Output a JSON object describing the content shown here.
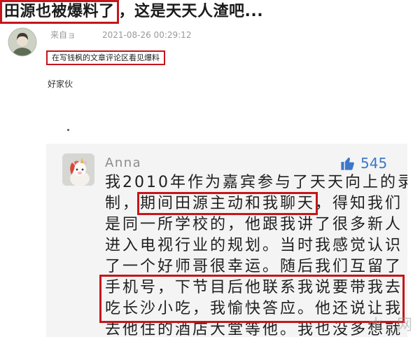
{
  "post": {
    "title_highlight": "田源也被爆料了",
    "title_rest": "，这是天天人渣吧...",
    "author": "来自ョ",
    "timestamp": "2021-08-26 00:29:12",
    "note": "在写钱枫的文章评论区看见爆料",
    "body": "好家伙"
  },
  "quoted_comment": {
    "username": "Anna",
    "like_count": "545",
    "lines": [
      {
        "text": "我2010年作为嘉宾参与了天天向上的录"
      },
      {
        "before": "制，",
        "highlight": "期间田源主动和我聊天",
        "after": "，得知我们"
      },
      {
        "text": "是同一所学校的，他跟我讲了很多新人"
      },
      {
        "text": "进入电视行业的规划。当时我感觉认识"
      },
      {
        "text": "了一个好师哥很幸运。随后我们互留了"
      },
      {
        "text": "手机号，下节目后他联系我说要带我去"
      },
      {
        "text": "吃长沙小吃，我愉快答应。他还说让我"
      },
      {
        "text": "去他住的酒店大堂等他。我也没多想就"
      }
    ]
  },
  "watermark": "水 网",
  "icons": {
    "author_avatar": "user-avatar",
    "commenter_avatar": "unicorn-plush-avatar",
    "like": "thumbs-up-icon"
  },
  "colors": {
    "highlight_box": "#c4161c",
    "like_blue": "#3b79c8",
    "quote_panel_bg": "#f4f4f4",
    "meta_text": "#999999"
  }
}
